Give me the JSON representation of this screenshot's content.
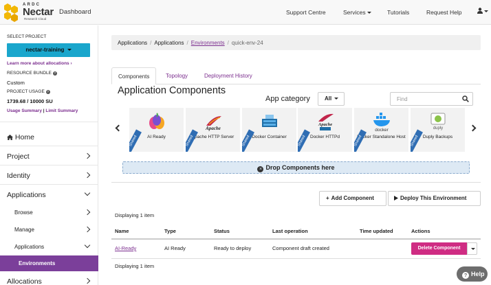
{
  "navbar": {
    "brand_top": "ARDC",
    "brand_name": "Nectar",
    "brand_sub": "Research Cloud",
    "dashboard": "Dashboard",
    "links": [
      "Support Centre",
      "Services",
      "Tutorials",
      "Request Help"
    ]
  },
  "sidebar": {
    "select_project_label": "SELECT PROJECT",
    "project_name": "nectar-training",
    "learn_more": "Learn more about allocations",
    "resource_bundle_label": "RESOURCE BUNDLE",
    "resource_bundle_value": "Custom",
    "project_usage_label": "PROJECT USAGE",
    "project_usage_value": "1739.68 / 10000 SU",
    "usage_summary": "Usage Summary",
    "limit_summary": "Limit Summary",
    "pipe": "|",
    "nav": {
      "home": "Home",
      "project": "Project",
      "identity": "Identity",
      "applications": "Applications",
      "browse": "Browse",
      "manage": "Manage",
      "applications_sub": "Applications",
      "environments": "Environments",
      "allocations": "Allocations"
    }
  },
  "breadcrumb": [
    "Applications",
    "Applications",
    "Environments",
    "quick-env-24"
  ],
  "tabs": [
    "Components",
    "Topology",
    "Deployment History"
  ],
  "components": {
    "title": "Application Components",
    "app_category_label": "App category",
    "app_category_value": "All",
    "find_placeholder": "Find",
    "cards": [
      {
        "name": "AI Ready",
        "ribbon": "Shared"
      },
      {
        "name": "Apache HTTP Server",
        "ribbon": "Shared"
      },
      {
        "name": "Docker Container",
        "ribbon": "Shared"
      },
      {
        "name": "Docker HTTPd",
        "ribbon": "Shared"
      },
      {
        "name": "Docker Standalone Host",
        "ribbon": "Shared"
      },
      {
        "name": "Duply Backups",
        "ribbon": "Shared"
      }
    ],
    "drop_zone": "Drop Components here"
  },
  "actions": {
    "add_component": "Add Component",
    "deploy_environment": "Deploy This Environment"
  },
  "table": {
    "displaying_top": "Displaying 1 item",
    "displaying_bottom": "Displaying 1 item",
    "headers": [
      "Name",
      "Type",
      "Status",
      "Last operation",
      "Time updated",
      "Actions"
    ],
    "rows": [
      {
        "name": "AI-Ready",
        "type": "AI Ready",
        "status": "Ready to deploy",
        "last_operation": "Component draft created",
        "time_updated": "",
        "action": "Delete Component"
      }
    ]
  },
  "help_button": "Help",
  "colors": {
    "accent_purple": "#7b3f9a",
    "project_button": "#1aa6cc",
    "delete_button": "#cf2c83",
    "drop_zone": "#dde9f4",
    "ribbon": "#2f6db3"
  }
}
